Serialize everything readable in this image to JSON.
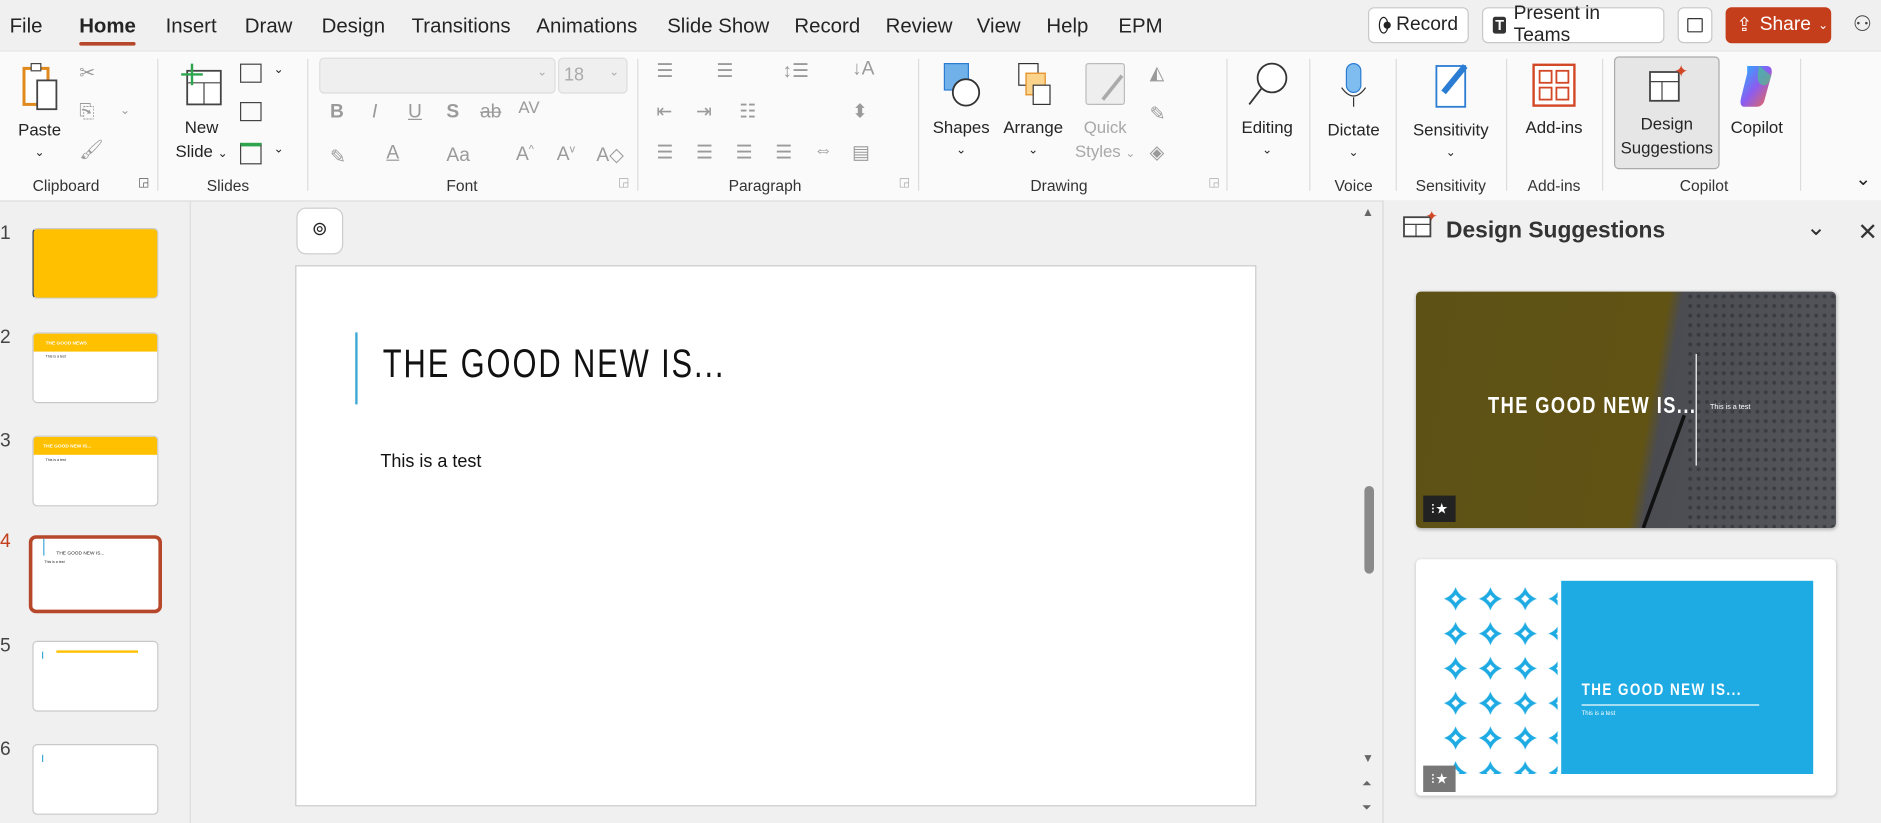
{
  "tabs": [
    "File",
    "Home",
    "Insert",
    "Draw",
    "Design",
    "Transitions",
    "Animations",
    "Slide Show",
    "Record",
    "Review",
    "View",
    "Help",
    "EPM"
  ],
  "title_buttons": {
    "record": "Record",
    "present": "Present in Teams",
    "share": "Share"
  },
  "ribbon": {
    "clipboard": {
      "paste": "Paste",
      "label": "Clipboard"
    },
    "slides": {
      "new_slide_line1": "New",
      "new_slide_line2": "Slide",
      "label": "Slides"
    },
    "font": {
      "font_name": "",
      "font_size": "18",
      "label": "Font"
    },
    "paragraph": {
      "label": "Paragraph"
    },
    "drawing": {
      "shapes": "Shapes",
      "arrange": "Arrange",
      "quick1": "Quick",
      "quick2": "Styles",
      "label": "Drawing"
    },
    "editing": {
      "label": "Editing"
    },
    "voice": {
      "dictate": "Dictate",
      "label": "Voice"
    },
    "sensitivity": {
      "button": "Sensitivity",
      "label": "Sensitivity"
    },
    "addins": {
      "button": "Add-ins",
      "label": "Add-ins"
    },
    "copilot": {
      "design1": "Design",
      "design2": "Suggestions",
      "copilot": "Copilot",
      "label": "Copilot"
    }
  },
  "slides": [
    {
      "num": "1",
      "title": ""
    },
    {
      "num": "2",
      "title": "THE GOOD NEWS",
      "body": "This is a test"
    },
    {
      "num": "3",
      "title": "THE GOOD NEW IS...",
      "body": "This is a test"
    },
    {
      "num": "4",
      "title": "THE GOOD NEW IS...",
      "body": "This is a test"
    },
    {
      "num": "5",
      "title": ""
    },
    {
      "num": "6",
      "title": ""
    }
  ],
  "current_slide": {
    "title": "THE GOOD NEW IS...",
    "body": "This is a test"
  },
  "design_pane": {
    "title": "Design Suggestions",
    "suggestions": [
      {
        "title": "THE GOOD NEW IS...",
        "body": "This is a test"
      },
      {
        "title": "THE GOOD NEW IS...",
        "body": "This is a test"
      }
    ]
  },
  "colors": {
    "accent": "#b7472a",
    "share": "#c43e1c",
    "slide_accent": "#3fa9d6",
    "yellow": "#ffc000",
    "blue": "#1eaae2"
  }
}
